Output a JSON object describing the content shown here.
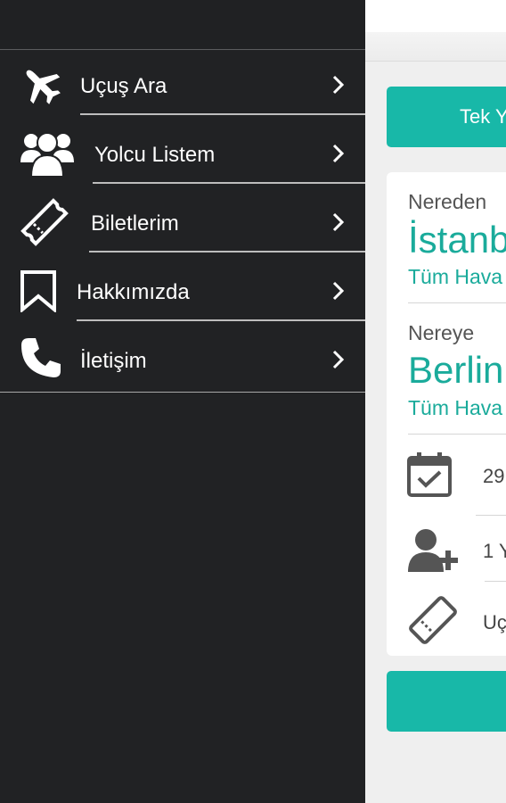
{
  "menu": {
    "items": [
      {
        "label": "Uçuş Ara",
        "icon": "airplane-icon"
      },
      {
        "label": "Yolcu Listem",
        "icon": "users-icon"
      },
      {
        "label": "Biletlerim",
        "icon": "ticket-icon"
      },
      {
        "label": "Hakkımızda",
        "icon": "bookmark-icon"
      },
      {
        "label": "İletişim",
        "icon": "phone-icon"
      }
    ]
  },
  "search": {
    "trip_tab_label": "Tek Y",
    "from_label": "Nereden",
    "from_city": "İstanb",
    "from_airport": "Tüm Hava",
    "to_label": "Nereye",
    "to_city": "Berlin",
    "to_airport": "Tüm Hava",
    "date_value": "29",
    "passenger_value": "1 Y",
    "flight_class_value": "Uç"
  },
  "colors": {
    "accent": "#18b8a8",
    "drawer_bg": "#212224"
  }
}
